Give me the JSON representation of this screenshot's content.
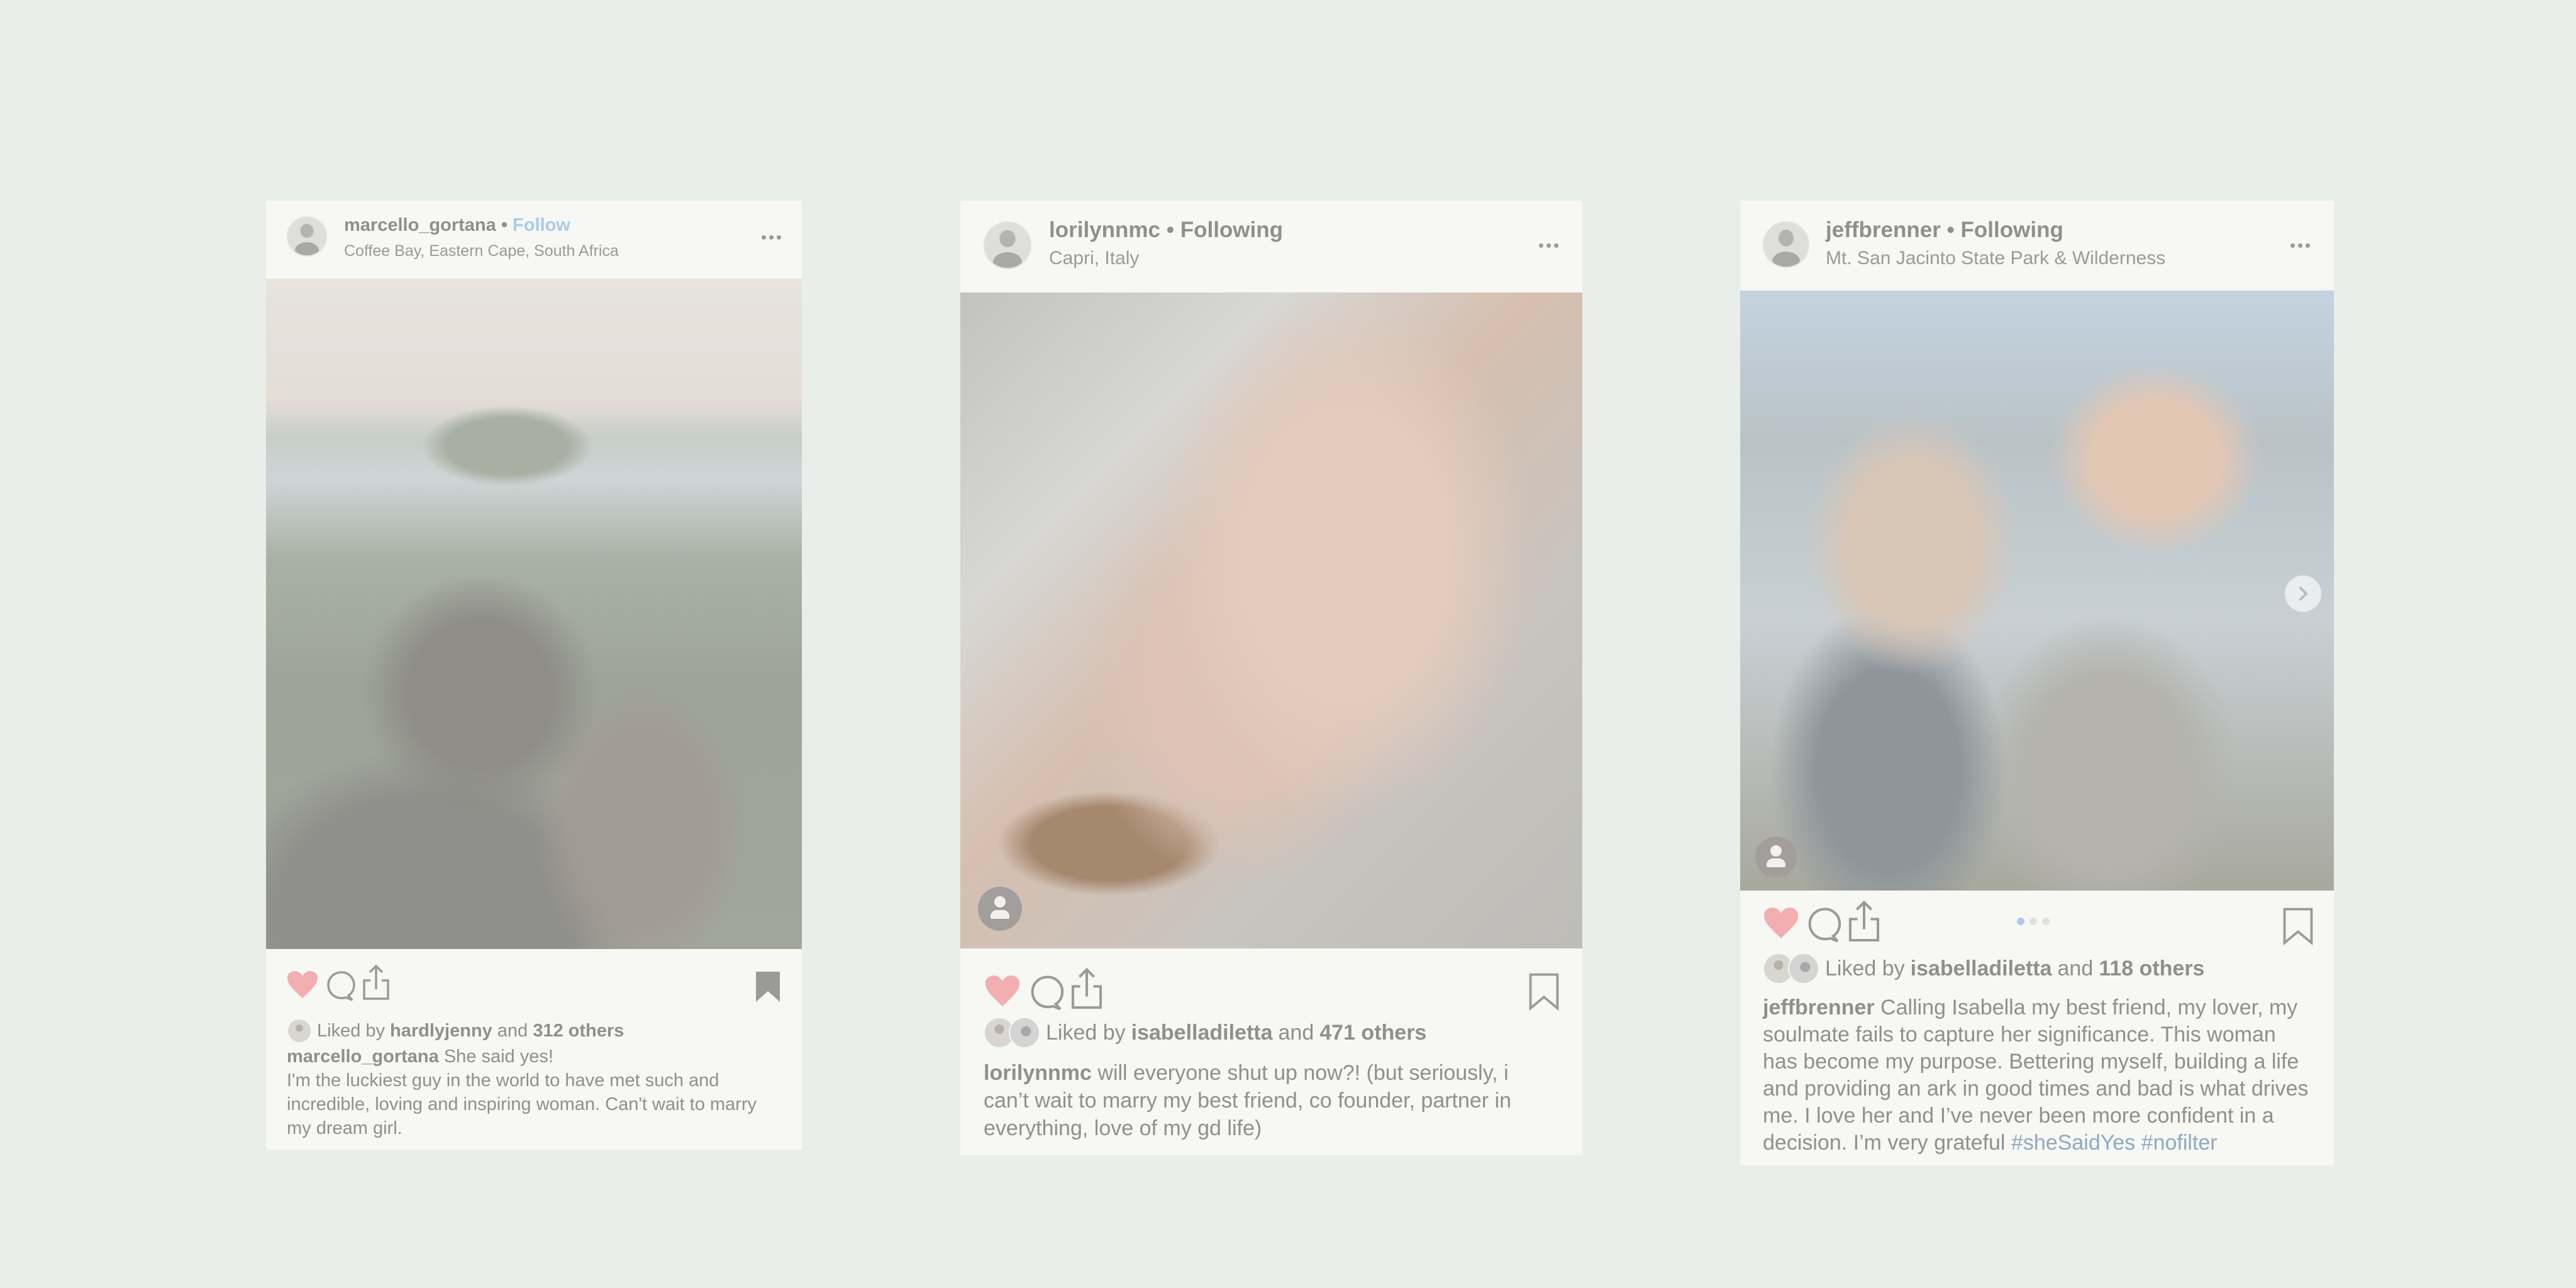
{
  "colors": {
    "background": "#e9eeeb",
    "card": "#f7f7f3",
    "text": "#8f908c",
    "link": "#a9cbe9",
    "hashtag": "#8fa9c2",
    "like": "#f2aeb0"
  },
  "posts": [
    {
      "username": "marcello_gortana",
      "separator": "•",
      "follow_label": "Follow",
      "location": "Coffee Bay, Eastern Cape, South Africa",
      "more_icon": "more-horizontal-icon",
      "photo_alt": "Couple kissing at a coastal lookout",
      "liked": true,
      "saved": true,
      "likes": {
        "prefix": "Liked by",
        "user": "hardlyjenny",
        "joiner": "and",
        "count": "312 others"
      },
      "caption": {
        "user": "marcello_gortana",
        "text": "She said yes!",
        "text2": "I'm the luckiest guy in the world to have met such and incredible, loving and inspiring woman. Can't wait to marry my dream girl."
      }
    },
    {
      "username": "lorilynnmc",
      "separator": "•",
      "follow_label": "Following",
      "location": "Capri, Italy",
      "more_icon": "more-horizontal-icon",
      "photo_alt": "Hand with engagement ring resting on partner's hand",
      "liked": true,
      "saved": false,
      "has_user_tags": true,
      "likes": {
        "prefix": "Liked by",
        "user": "isabelladiletta",
        "joiner": "and",
        "count": "471 others"
      },
      "caption": {
        "user": "lorilynnmc",
        "text": "will everyone shut up now?! (but seriously, i can’t wait to marry my best friend, co founder, partner in everything, love of my gd life)"
      }
    },
    {
      "username": "jeffbrenner",
      "separator": "•",
      "follow_label": "Following",
      "location": "Mt. San Jacinto State Park & Wilderness",
      "more_icon": "more-horizontal-icon",
      "photo_alt": "Couple selfie on a mountain with trees",
      "liked": true,
      "saved": false,
      "has_user_tags": true,
      "carousel": {
        "current": 1,
        "total": 3
      },
      "likes": {
        "prefix": "Liked by",
        "user": "isabelladiletta",
        "joiner": "and",
        "count": "118 others"
      },
      "caption": {
        "user": "jeffbrenner",
        "text": "Calling Isabella my best friend, my lover, my soulmate fails to capture her significance. This woman has become my purpose. Bettering myself, building a life and providing an ark in good times and bad is what drives me. I love her and I’ve never been more confident in a decision. I’m very grateful",
        "hashtags": [
          "#sheSaidYes",
          "#nofilter"
        ]
      }
    }
  ]
}
